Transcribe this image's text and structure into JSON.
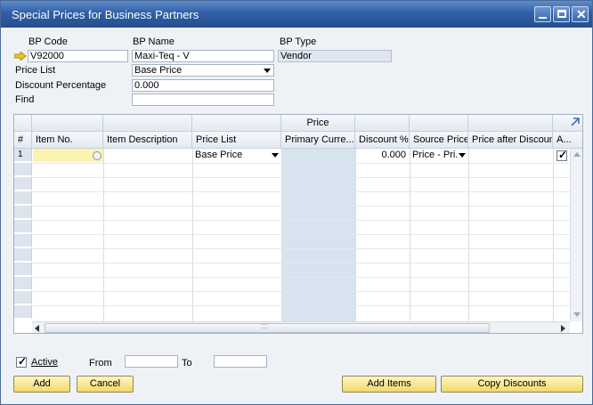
{
  "window": {
    "title": "Special Prices for Business Partners"
  },
  "form": {
    "bp_code_label": "BP Code",
    "bp_code_value": "V92000",
    "bp_name_label": "BP Name",
    "bp_name_value": "Maxi-Teq - V",
    "bp_type_label": "BP Type",
    "bp_type_value": "Vendor",
    "price_list_label": "Price List",
    "price_list_value": "Base Price",
    "discount_label": "Discount Percentage",
    "discount_value": "0.000",
    "find_label": "Find",
    "find_value": ""
  },
  "grid": {
    "group_header": "Price",
    "columns": [
      "#",
      "Item No.",
      "Item Description",
      "Price List",
      "Primary Curre...",
      "Discount %",
      "Source Price",
      "Price after Discount",
      "A..."
    ],
    "rows": [
      {
        "num": "1",
        "item_no": "",
        "item_description": "",
        "price_list": "Base Price",
        "primary_currency": "",
        "discount": "0.000",
        "source_price": "Price - Pri.",
        "price_after_discount": "",
        "active_checked": true
      }
    ],
    "empty_rows": 12,
    "hscroll_grip": ":::"
  },
  "footer": {
    "active_label": "Active",
    "active_checked": true,
    "from_label": "From",
    "from_value": "",
    "to_label": "To",
    "to_value": "",
    "add_button": "Add",
    "cancel_button": "Cancel",
    "add_items_button": "Add Items",
    "copy_discounts_button": "Copy Discounts"
  },
  "colors": {
    "title_bar": "#2f5fa6",
    "button": "#f2d86a",
    "focus_cell": "#fdf3b0",
    "readonly_column": "#d7e3ef"
  }
}
